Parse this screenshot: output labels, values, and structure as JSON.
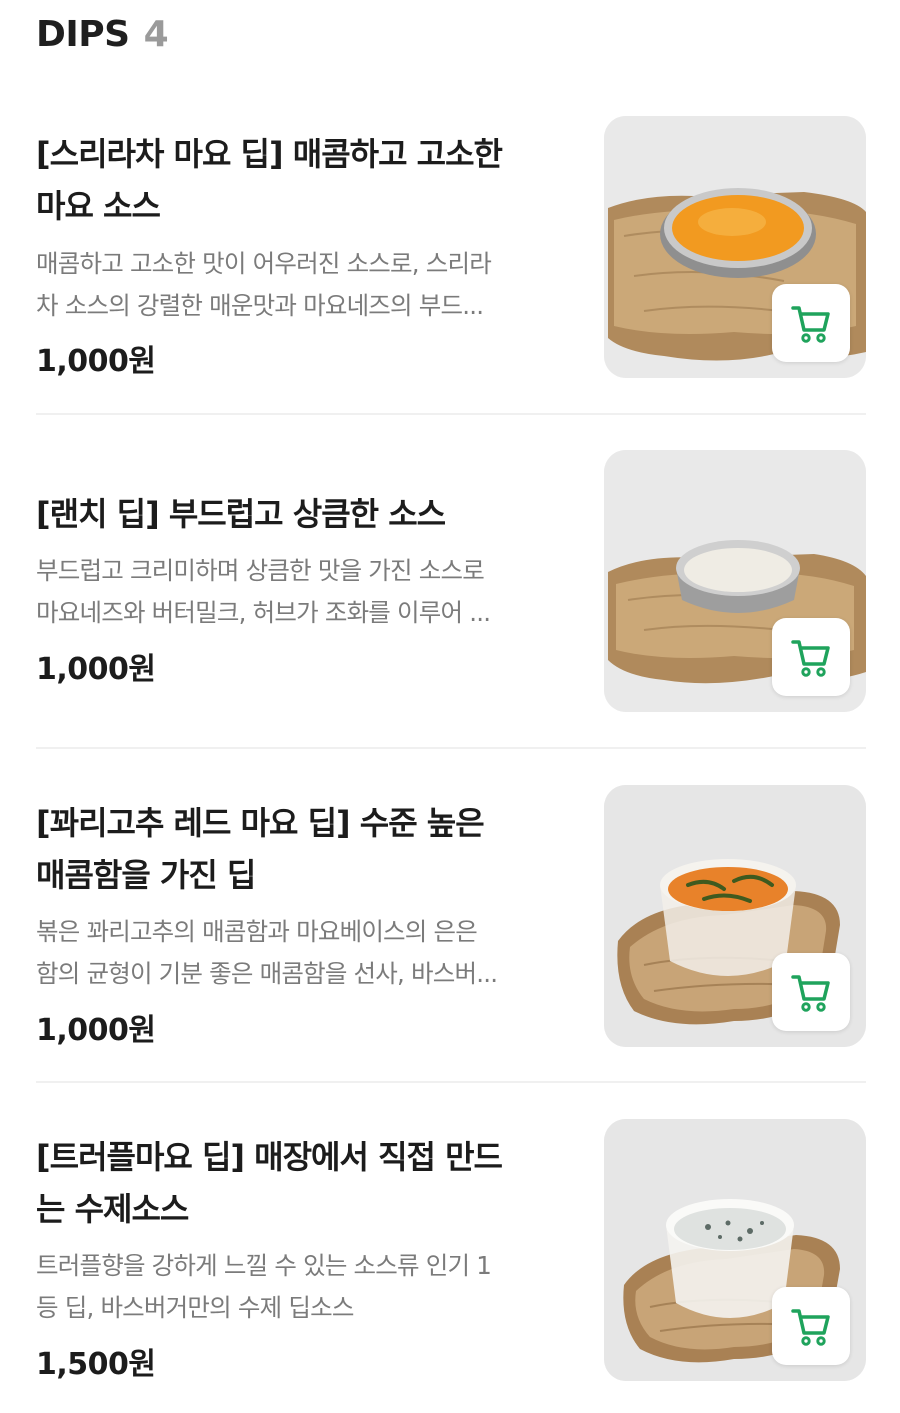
{
  "section": {
    "title": "DIPS",
    "count": "4"
  },
  "items": [
    {
      "name_lines": [
        "[스리라차 마요 딥] 매콤하고 고소한",
        "마요 소스"
      ],
      "desc_lines": [
        "매콤하고 고소한 맛이 어우러진 소스로, 스리라",
        "차 소스의 강렬한 매운맛과 마요네즈의 부드..."
      ],
      "price": "1,000원"
    },
    {
      "name_lines": [
        "[랜치 딥] 부드럽고 상큼한 소스"
      ],
      "desc_lines": [
        "부드럽고 크리미하며 상큼한 맛을 가진 소스로",
        "마요네즈와 버터밀크, 허브가 조화를 이루어 ..."
      ],
      "price": "1,000원"
    },
    {
      "name_lines": [
        "[꽈리고추 레드 마요 딥] 수준 높은",
        "매콤함을 가진 딥"
      ],
      "desc_lines": [
        "볶은 꽈리고추의 매콤함과 마요베이스의 은은",
        "함의 균형이 기분 좋은 매콤함을 선사, 바스버..."
      ],
      "price": "1,000원"
    },
    {
      "name_lines": [
        "[트러플마요 딥] 매장에서 직접 만드",
        "는 수제소스"
      ],
      "desc_lines": [
        "트러플향을 강하게 느낄 수 있는 소스류 인기 1",
        "등 딥, 바스버거만의 수제 딥소스"
      ],
      "price": "1,500원"
    }
  ],
  "colors": {
    "accent": "#1fa35c",
    "divider": "#f0f0f0",
    "desc": "#7b7b7b"
  }
}
